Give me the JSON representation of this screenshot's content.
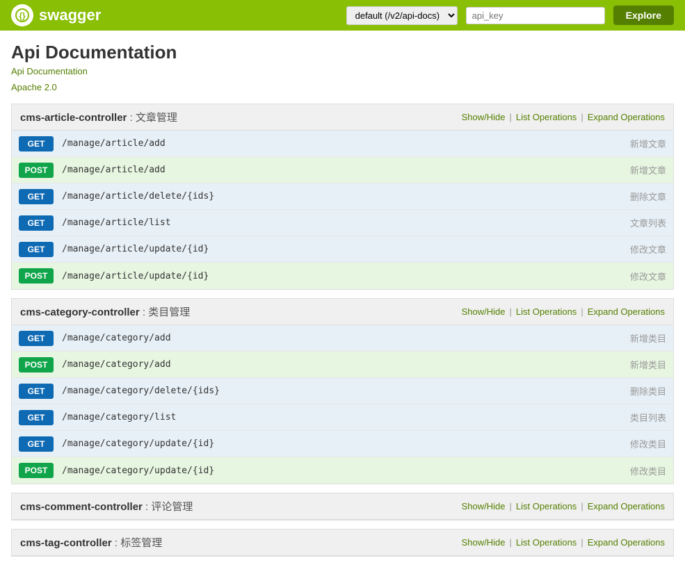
{
  "header": {
    "logo_text": "swagger",
    "logo_icon": "{ }",
    "select_value": "default (/v2/api-docs)",
    "select_options": [
      "default (/v2/api-docs)"
    ],
    "apikey_placeholder": "api_key",
    "explore_label": "Explore"
  },
  "page": {
    "title": "Api Documentation",
    "subtitle": "Api Documentation",
    "license_text": "Apache 2.0"
  },
  "controllers": [
    {
      "id": "cms-article-controller",
      "name": "cms-article-controller",
      "cn_name": "文章管理",
      "show_hide": "Show/Hide",
      "list_ops": "List Operations",
      "expand_ops": "Expand Operations",
      "expanded": true,
      "routes": [
        {
          "method": "GET",
          "path": "/manage/article/add",
          "desc": "新增文章"
        },
        {
          "method": "POST",
          "path": "/manage/article/add",
          "desc": "新增文章"
        },
        {
          "method": "GET",
          "path": "/manage/article/delete/{ids}",
          "desc": "删除文章"
        },
        {
          "method": "GET",
          "path": "/manage/article/list",
          "desc": "文章列表"
        },
        {
          "method": "GET",
          "path": "/manage/article/update/{id}",
          "desc": "修改文章"
        },
        {
          "method": "POST",
          "path": "/manage/article/update/{id}",
          "desc": "修改文章"
        }
      ]
    },
    {
      "id": "cms-category-controller",
      "name": "cms-category-controller",
      "cn_name": "类目管理",
      "show_hide": "Show/Hide",
      "list_ops": "List Operations",
      "expand_ops": "Expand Operations",
      "expanded": true,
      "routes": [
        {
          "method": "GET",
          "path": "/manage/category/add",
          "desc": "新增类目"
        },
        {
          "method": "POST",
          "path": "/manage/category/add",
          "desc": "新增类目"
        },
        {
          "method": "GET",
          "path": "/manage/category/delete/{ids}",
          "desc": "删除类目"
        },
        {
          "method": "GET",
          "path": "/manage/category/list",
          "desc": "类目列表"
        },
        {
          "method": "GET",
          "path": "/manage/category/update/{id}",
          "desc": "修改类目"
        },
        {
          "method": "POST",
          "path": "/manage/category/update/{id}",
          "desc": "修改类目"
        }
      ]
    },
    {
      "id": "cms-comment-controller",
      "name": "cms-comment-controller",
      "cn_name": "评论管理",
      "show_hide": "Show/Hide",
      "list_ops": "List Operations",
      "expand_ops": "Expand Operations",
      "expanded": false,
      "routes": []
    },
    {
      "id": "cms-tag-controller",
      "name": "cms-tag-controller",
      "cn_name": "标签管理",
      "show_hide": "Show/Hide",
      "list_ops": "List Operations",
      "expand_ops": "Expand Operations",
      "expanded": false,
      "routes": []
    }
  ]
}
